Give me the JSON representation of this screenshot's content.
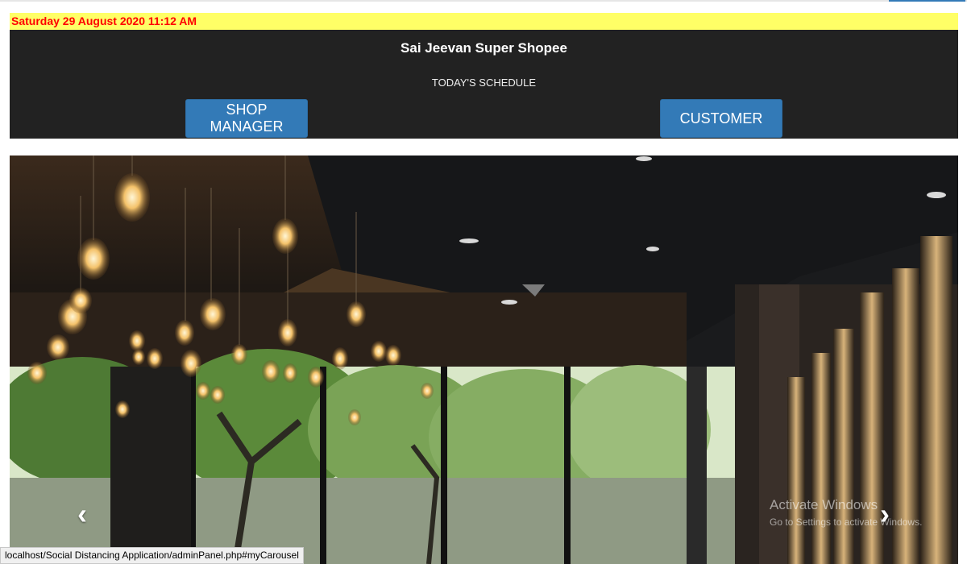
{
  "header": {
    "datetime": "Saturday 29 August 2020 11:12 AM",
    "shop_name": "Sai Jeevan Super Shopee",
    "schedule_label": "TODAY'S SCHEDULE"
  },
  "buttons": {
    "shop_manager": "SHOP MANAGER",
    "customer": "CUSTOMER"
  },
  "carousel": {
    "prev_icon": "chevron-left-icon",
    "next_icon": "chevron-right-icon",
    "prev_glyph": "‹",
    "next_glyph": "›"
  },
  "watermark": {
    "title": "Activate Windows",
    "subtitle": "Go to Settings to activate Windows."
  },
  "status_bar": {
    "url": "localhost/Social Distancing Application/adminPanel.php#myCarousel"
  },
  "colors": {
    "date_bar_bg": "#ffff66",
    "date_text": "#ff0000",
    "header_bg": "#222222",
    "button_bg": "#337ab7"
  }
}
